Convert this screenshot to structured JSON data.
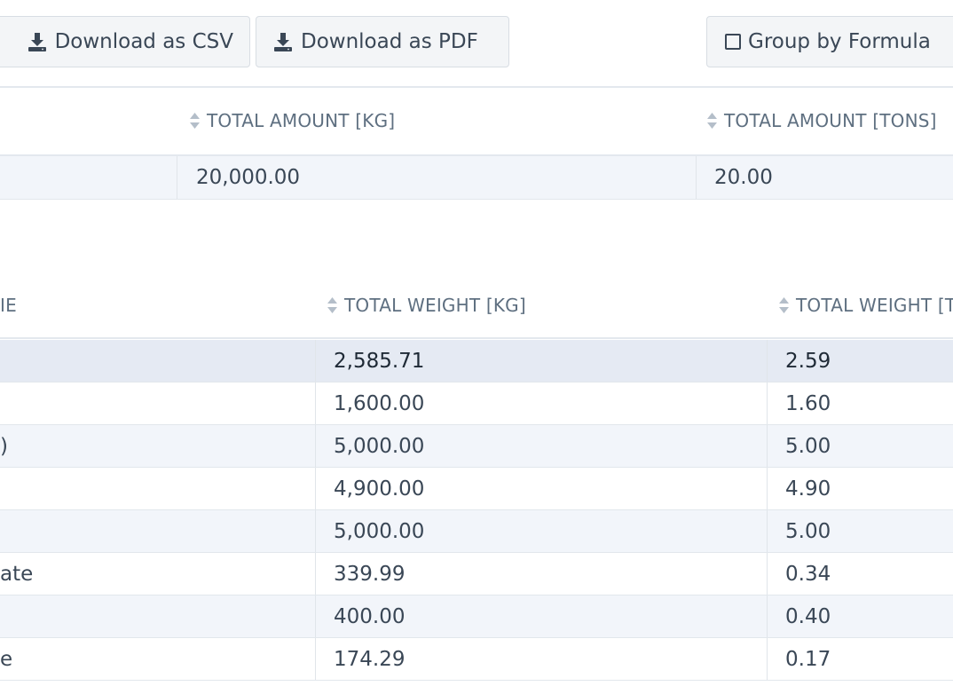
{
  "toolbar": {
    "csv_label": "Download as CSV",
    "pdf_label": "Download as PDF",
    "group_label": "Group by Formula"
  },
  "summary_table": {
    "headers": [
      "TOTAL AMOUNT [KG]",
      "TOTAL AMOUNT [TONS]"
    ],
    "row": [
      "20,000.00",
      "20.00"
    ]
  },
  "detail_table": {
    "headers": [
      "IE",
      "TOTAL WEIGHT [KG]",
      "TOTAL WEIGHT [T"
    ],
    "rows": [
      {
        "name": "",
        "kg": "2,585.71",
        "t": "2.59"
      },
      {
        "name": "",
        "kg": "1,600.00",
        "t": "1.60"
      },
      {
        "name": ")",
        "kg": "5,000.00",
        "t": "5.00"
      },
      {
        "name": "",
        "kg": "4,900.00",
        "t": "4.90"
      },
      {
        "name": "",
        "kg": "5,000.00",
        "t": "5.00"
      },
      {
        "name": "ate",
        "kg": "339.99",
        "t": "0.34"
      },
      {
        "name": "",
        "kg": "400.00",
        "t": "0.40"
      },
      {
        "name": "e",
        "kg": "174.29",
        "t": "0.17"
      }
    ]
  },
  "colors": {
    "header_text": "#5e6f80",
    "row_alt": "#f2f5fa",
    "row_highlight": "#e5eaf3",
    "button_bg": "#f3f5f7"
  }
}
